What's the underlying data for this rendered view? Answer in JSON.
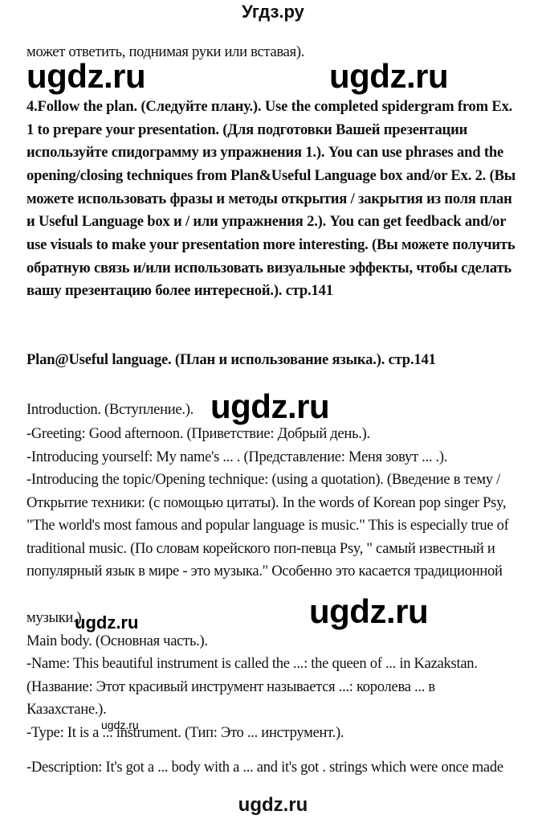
{
  "header": {
    "site_title": "Угдз.ру"
  },
  "watermarks": {
    "text": "ugdz.ru"
  },
  "intro_line": "может ответить, поднимая руки или вставая).",
  "task4": {
    "lines": [
      "4.Follow the plan. (Следуйте плану.). Use the completed spidergram from Ex.",
      "1 to prepare your presentation. (Для подготовки Вашей презентации",
      "используйте спидограмму из упражнения 1.). You can use phrases and the",
      "opening/closing techniques from Plan&Useful Language box and/or Ex. 2. (Вы",
      "можете использовать фразы и методы открытия / закрытия из поля план",
      "и Useful Language box  и / или упражнения 2.). You can get feedback and/or",
      "use visuals to make your presentation more interesting. (Вы можете получить",
      "обратную связь и/или использовать визуальные эффекты, чтобы сделать",
      "вашу презентацию более интересной.). стр.141"
    ]
  },
  "plan_heading": "Plan@Useful language. (План и использование языка.). стр.141",
  "plan": {
    "introduction": "Introduction. (Вступление.).",
    "greeting": "-Greeting: Good afternoon. (Приветствие: Добрый день.).",
    "introducing_yourself": "-Introducing yourself: My name's ... . (Представление: Меня зовут ... .).",
    "topic_lines": [
      "-Introducing the topic/Opening technique: (using a quotation). (Введение в тему /",
      "Открытие техники: (с помощью цитаты). In the words of Korean pop singer Psy,",
      "\"The world's most famous and popular language is music.\" This is especially true of",
      "traditional music. (По словам корейского поп-певца Psy, \" самый известный и",
      "популярный язык в мире - это музыка.\" Особенно это касается традиционной",
      "музыки.)."
    ],
    "main_body": "Main body. (Основная часть.).",
    "name_lines": [
      "-Name: This beautiful instrument is called the ...: the queen of ... in Kazakstan.",
      "(Название: Этот красивый инструмент называется  ...: королева ... в",
      "Казахстане.)."
    ],
    "type": "-Type: It is a ... instrument. (Тип: Это ... инструмент.).",
    "description": "-Description: It's got a ... body with a ... and it's got . strings which were once made"
  }
}
